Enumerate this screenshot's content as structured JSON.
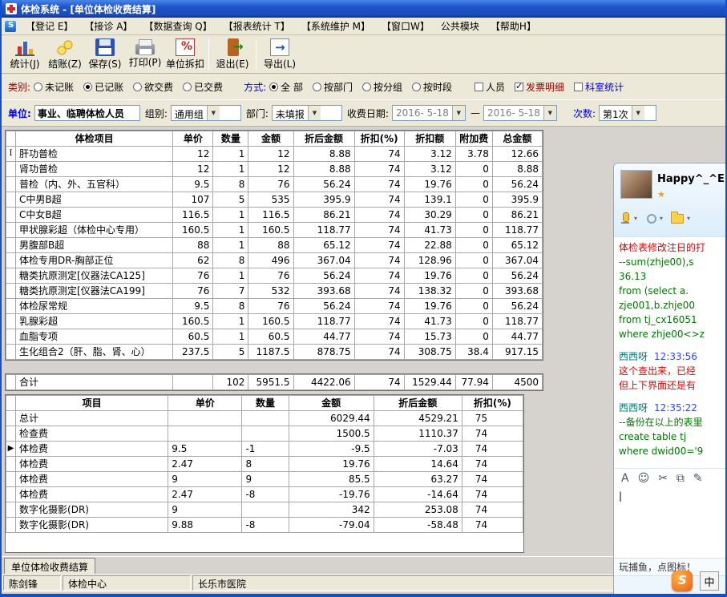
{
  "window": {
    "title": "体检系统 - [单位体检收费结算]"
  },
  "menu": {
    "items": [
      {
        "id": "register",
        "label": "【登记 E】"
      },
      {
        "id": "reception",
        "label": "【接诊 A】"
      },
      {
        "id": "data-query",
        "label": "【数据查询 Q】"
      },
      {
        "id": "report-stats",
        "label": "【报表统计 T】"
      },
      {
        "id": "system-maint",
        "label": "【系统维护 M】"
      },
      {
        "id": "window",
        "label": "【窗口W】"
      },
      {
        "id": "public-module",
        "label": "公共模块"
      },
      {
        "id": "help",
        "label": "【帮助H】"
      }
    ]
  },
  "toolbar": {
    "buttons": [
      {
        "id": "stats",
        "label": "统计(J)"
      },
      {
        "id": "settle",
        "label": "结账(Z)"
      },
      {
        "id": "save",
        "label": "保存(S)"
      },
      {
        "id": "print",
        "label": "打印(P)"
      },
      {
        "id": "unit-discount",
        "label": "单位拆扣"
      },
      {
        "id": "exit",
        "label": "退出(E)"
      },
      {
        "id": "export",
        "label": "导出(L)"
      }
    ]
  },
  "filters": {
    "category_label": "类别:",
    "category_options": [
      {
        "id": "unposted",
        "label": "未记账",
        "selected": false
      },
      {
        "id": "posted",
        "label": "已记账",
        "selected": true
      },
      {
        "id": "to-pay",
        "label": "欲交费",
        "selected": false
      },
      {
        "id": "paid",
        "label": "已交费",
        "selected": false
      }
    ],
    "mode_label": "方式:",
    "mode_options": [
      {
        "id": "all",
        "label": "全  部",
        "selected": true
      },
      {
        "id": "by-dept",
        "label": "按部门",
        "selected": false
      },
      {
        "id": "by-group",
        "label": "按分组",
        "selected": false
      },
      {
        "id": "by-time",
        "label": "按时段",
        "selected": false
      }
    ],
    "check_options": [
      {
        "id": "personnel",
        "label": "人员",
        "checked": false,
        "color": "#000000"
      },
      {
        "id": "invoice-detail",
        "label": "发票明细",
        "checked": true,
        "color": "#a00000"
      },
      {
        "id": "dept-stats",
        "label": "科室统计",
        "checked": false,
        "color": "#0000cc"
      }
    ]
  },
  "params": {
    "unit_label": "单位:",
    "unit_value": "事业、临聘体检人员",
    "group_label": "组别:",
    "group_value": "通用组",
    "dept_label": "部门:",
    "dept_value": "未填报",
    "date_label": "收费日期:",
    "date_from": "2016- 5-18",
    "date_sep": "—",
    "date_to": "2016- 5-18",
    "times_label": "次数:",
    "times_value": "第1次"
  },
  "main_table": {
    "headers": [
      "体检项目",
      "单价",
      "数量",
      "金额",
      "折后金额",
      "折扣(%)",
      "折扣额",
      "附加费",
      "总金额"
    ],
    "indicator": {
      "row": 0,
      "glyph": "I"
    },
    "rows": [
      [
        "肝功普检",
        "12",
        "1",
        "12",
        "8.88",
        "74",
        "3.12",
        "3.78",
        "12.66"
      ],
      [
        "肾功普检",
        "12",
        "1",
        "12",
        "8.88",
        "74",
        "3.12",
        "0",
        "8.88"
      ],
      [
        "普检（内、外、五官科）",
        "9.5",
        "8",
        "76",
        "56.24",
        "74",
        "19.76",
        "0",
        "56.24"
      ],
      [
        "C中男B超",
        "107",
        "5",
        "535",
        "395.9",
        "74",
        "139.1",
        "0",
        "395.9"
      ],
      [
        "C中女B超",
        "116.5",
        "1",
        "116.5",
        "86.21",
        "74",
        "30.29",
        "0",
        "86.21"
      ],
      [
        "甲状腺彩超（体检中心专用）",
        "160.5",
        "1",
        "160.5",
        "118.77",
        "74",
        "41.73",
        "0",
        "118.77"
      ],
      [
        "男腹部B超",
        "88",
        "1",
        "88",
        "65.12",
        "74",
        "22.88",
        "0",
        "65.12"
      ],
      [
        "体检专用DR-胸部正位",
        "62",
        "8",
        "496",
        "367.04",
        "74",
        "128.96",
        "0",
        "367.04"
      ],
      [
        "糖类抗原测定[仪器法CA125]",
        "76",
        "1",
        "76",
        "56.24",
        "74",
        "19.76",
        "0",
        "56.24"
      ],
      [
        "糖类抗原测定[仪器法CA199]",
        "76",
        "7",
        "532",
        "393.68",
        "74",
        "138.32",
        "0",
        "393.68"
      ],
      [
        "体检尿常规",
        "9.5",
        "8",
        "76",
        "56.24",
        "74",
        "19.76",
        "0",
        "56.24"
      ],
      [
        "乳腺彩超",
        "160.5",
        "1",
        "160.5",
        "118.77",
        "74",
        "41.73",
        "0",
        "118.77"
      ],
      [
        "血脂专项",
        "60.5",
        "1",
        "60.5",
        "44.77",
        "74",
        "15.73",
        "0",
        "44.77"
      ],
      [
        "生化组合2（肝、脂、肾、心）",
        "237.5",
        "5",
        "1187.5",
        "878.75",
        "74",
        "308.75",
        "38.4",
        "917.15"
      ]
    ],
    "total_row": [
      "合计",
      "",
      "102",
      "5951.5",
      "4422.06",
      "74",
      "1529.44",
      "77.94",
      "4500"
    ]
  },
  "summary_table": {
    "headers": [
      "项目",
      "单价",
      "数量",
      "金额",
      "折后金额",
      "折扣(%)"
    ],
    "indicator": {
      "row": 2,
      "glyph": "▶"
    },
    "rows": [
      [
        "总计",
        "",
        "",
        "6029.44",
        "4529.21",
        "75"
      ],
      [
        "检查费",
        "",
        "",
        "1500.5",
        "1110.37",
        "74"
      ],
      [
        "体检费",
        "9.5",
        "-1",
        "-9.5",
        "-7.03",
        "74"
      ],
      [
        "体检费",
        "2.47",
        "8",
        "19.76",
        "14.64",
        "74"
      ],
      [
        "体检费",
        "9",
        "9",
        "85.5",
        "63.27",
        "74"
      ],
      [
        "体检费",
        "2.47",
        "-8",
        "-19.76",
        "-14.64",
        "74"
      ],
      [
        "数字化摄影(DR)",
        "9",
        "",
        "342",
        "253.08",
        "74"
      ],
      [
        "数字化摄影(DR)",
        "9.88",
        "-8",
        "-79.04",
        "-58.48",
        "74"
      ]
    ]
  },
  "bottom_tab": {
    "label": "单位体检收费结算"
  },
  "status_bar": {
    "panels": [
      "陈剑锋",
      "体检中心",
      "长乐市医院"
    ]
  },
  "chat": {
    "title": "Happy^_^E",
    "star": "★",
    "messages": [
      {
        "text": "体检表修改注日的打",
        "color": "red"
      },
      {
        "text": "--sum(zhje00),s",
        "color": "green"
      },
      {
        "text": "36.13",
        "color": "green"
      },
      {
        "text": "from (select a.",
        "color": "green"
      },
      {
        "text": "zje001,b.zhje00",
        "color": "green"
      },
      {
        "text": "from tj_cx16051",
        "color": "green"
      },
      {
        "text": "where zhje00<>z",
        "color": "green"
      },
      {
        "meta": true,
        "name": "西西呀",
        "time": "12:33:56"
      },
      {
        "text": "这个查出来，已经",
        "color": "red"
      },
      {
        "text": "但上下界面还是有",
        "color": "red"
      },
      {
        "meta": true,
        "name": "西西呀",
        "time": "12:35:22"
      },
      {
        "text": "--备份在以上的表里",
        "color": "green"
      },
      {
        "text": "create table tj",
        "color": "green"
      },
      {
        "text": "where dwid00='9",
        "color": "green"
      }
    ],
    "input_cursor": "|",
    "promo": "玩捕鱼，点图标！"
  },
  "icons": {
    "chat_tools": [
      {
        "id": "font",
        "glyph": "A"
      },
      {
        "id": "emoticon",
        "glyph": "☺"
      },
      {
        "id": "screenshot",
        "glyph": "✂"
      },
      {
        "id": "chat-history",
        "glyph": "⧉"
      },
      {
        "id": "edit",
        "glyph": "✎"
      }
    ]
  },
  "floatbar": {
    "ime_label": "中"
  },
  "colors": {
    "title_blue": "#1a50c0",
    "label_red": "#a00000",
    "label_blue": "#0000cc",
    "sql_green": "#007700",
    "msg_red": "#e80000",
    "time_blue": "#3344ee",
    "promo_orange": "#f06000"
  }
}
